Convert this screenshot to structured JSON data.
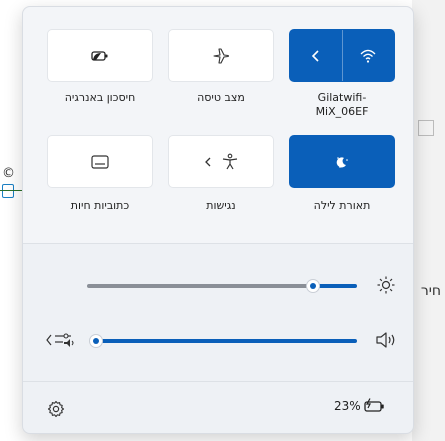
{
  "quick_actions": {
    "tiles": [
      {
        "label": "Gilatwifi-\nMiX_06EF",
        "state": "on",
        "icon": "wifi-icon",
        "secondary_icon": "chevron-left-icon"
      },
      {
        "label": "מצב טיסה",
        "state": "off",
        "icon": "airplane-icon"
      },
      {
        "label": "חיסכון באנרגיה",
        "state": "off",
        "icon": "battery-saver-icon"
      },
      {
        "label": "תאורת לילה",
        "state": "on",
        "icon": "night-light-icon"
      },
      {
        "label": "נגישות",
        "state": "off",
        "icon": "accessibility-icon",
        "secondary_icon": "chevron-left-icon"
      },
      {
        "label": "כתוביות חיות",
        "state": "off",
        "icon": "live-captions-icon"
      }
    ]
  },
  "sliders": {
    "brightness": {
      "icon": "brightness-icon",
      "level": 0.85
    },
    "volume": {
      "icon": "speaker-icon",
      "level": 0.0,
      "device_icon": "audio-output-icon"
    }
  },
  "footer": {
    "settings_icon": "gear-icon",
    "battery_percent": "23%",
    "battery_icon": "battery-charging-icon"
  },
  "colors": {
    "accent": "#0a5fb9",
    "panel": "#eef1f5",
    "highlight": "#f4ec12"
  },
  "background": {
    "right_fragment_text": "חיר"
  }
}
